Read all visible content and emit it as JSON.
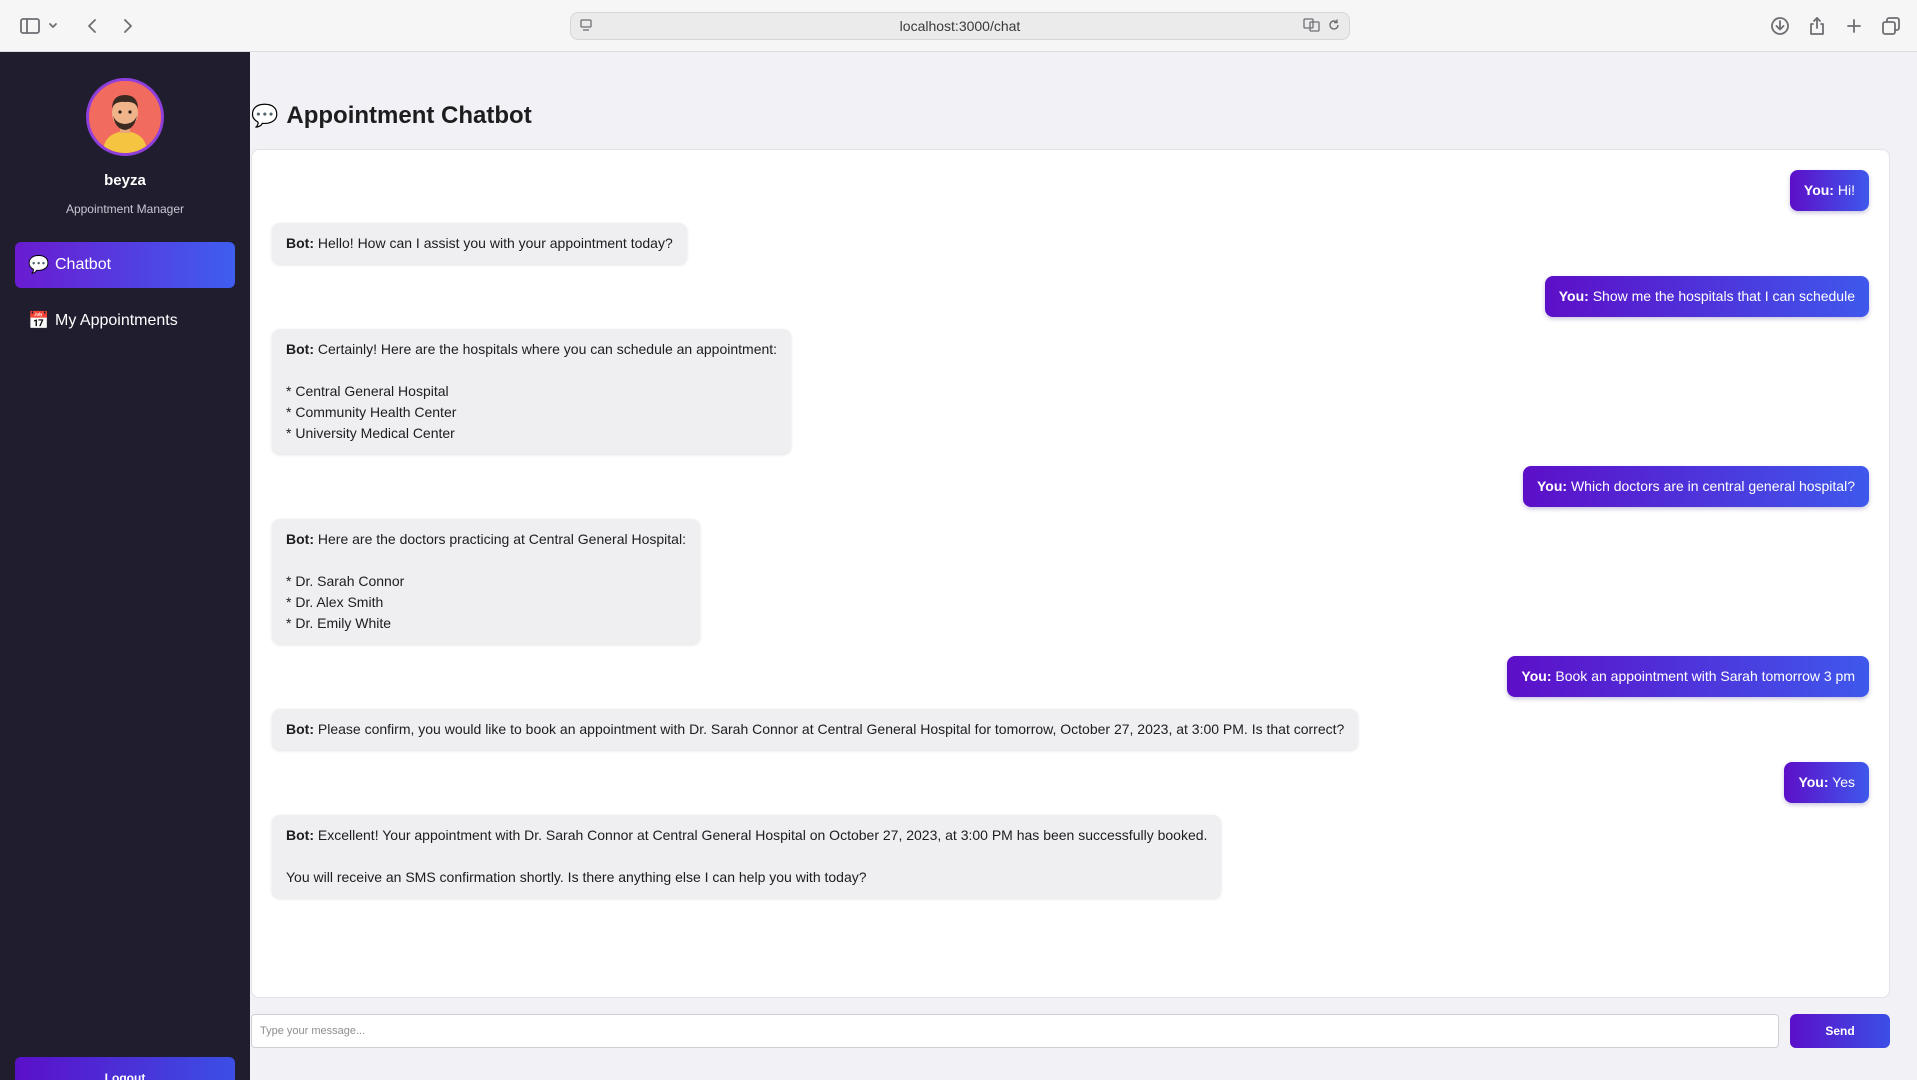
{
  "browser": {
    "url": "localhost:3000/chat"
  },
  "sidebar": {
    "user_name": "beyza",
    "user_role": "Appointment Manager",
    "items": [
      {
        "emoji": "💬",
        "label": "Chatbot",
        "active": true
      },
      {
        "emoji": "📅",
        "label": "My Appointments",
        "active": false
      }
    ],
    "logout_label": "Logout"
  },
  "main": {
    "title_emoji": "💬",
    "title": "Appointment Chatbot",
    "messages": [
      {
        "sender": "You:",
        "text": "Hi!"
      },
      {
        "sender": "Bot:",
        "text": "Hello! How can I assist you with your appointment today?"
      },
      {
        "sender": "You:",
        "text": "Show me the hospitals that I can schedule"
      },
      {
        "sender": "Bot:",
        "text": "Certainly! Here are the hospitals where you can schedule an appointment:\n\n* Central General Hospital\n* Community Health Center\n* University Medical Center"
      },
      {
        "sender": "You:",
        "text": "Which doctors are in central general hospital?"
      },
      {
        "sender": "Bot:",
        "text": "Here are the doctors practicing at Central General Hospital:\n\n* Dr. Sarah Connor\n* Dr. Alex Smith\n* Dr. Emily White"
      },
      {
        "sender": "You:",
        "text": "Book an appointment with Sarah tomorrow 3 pm"
      },
      {
        "sender": "Bot:",
        "text": "Please confirm, you would like to book an appointment with Dr. Sarah Connor at Central General Hospital for tomorrow, October 27, 2023, at 3:00 PM. Is that correct?"
      },
      {
        "sender": "You:",
        "text": "Yes"
      },
      {
        "sender": "Bot:",
        "text": "Excellent! Your appointment with Dr. Sarah Connor at Central General Hospital on October 27, 2023, at 3:00 PM has been successfully booked.\n\nYou will receive an SMS confirmation shortly. Is there anything else I can help you with today?"
      }
    ],
    "input_placeholder": "Type your message...",
    "send_label": "Send"
  }
}
